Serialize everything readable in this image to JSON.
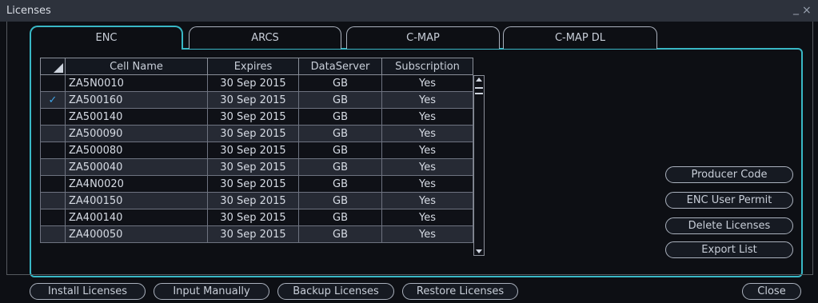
{
  "window": {
    "title": "Licenses",
    "minimize_glyph": "_",
    "close_glyph": "×"
  },
  "tabs": [
    {
      "label": "ENC",
      "active": true
    },
    {
      "label": "ARCS",
      "active": false
    },
    {
      "label": "C-MAP",
      "active": false
    },
    {
      "label": "C-MAP DL",
      "active": false
    }
  ],
  "table": {
    "columns": [
      "Cell Name",
      "Expires",
      "DataServer",
      "Subscription"
    ],
    "rows": [
      {
        "checked": false,
        "cell_name": "ZA5N0010",
        "expires": "30 Sep 2015",
        "dataserver": "GB",
        "subscription": "Yes"
      },
      {
        "checked": true,
        "cell_name": "ZA500160",
        "expires": "30 Sep 2015",
        "dataserver": "GB",
        "subscription": "Yes"
      },
      {
        "checked": false,
        "cell_name": "ZA500140",
        "expires": "30 Sep 2015",
        "dataserver": "GB",
        "subscription": "Yes"
      },
      {
        "checked": false,
        "cell_name": "ZA500090",
        "expires": "30 Sep 2015",
        "dataserver": "GB",
        "subscription": "Yes"
      },
      {
        "checked": false,
        "cell_name": "ZA500080",
        "expires": "30 Sep 2015",
        "dataserver": "GB",
        "subscription": "Yes"
      },
      {
        "checked": false,
        "cell_name": "ZA500040",
        "expires": "30 Sep 2015",
        "dataserver": "GB",
        "subscription": "Yes"
      },
      {
        "checked": false,
        "cell_name": "ZA4N0020",
        "expires": "30 Sep 2015",
        "dataserver": "GB",
        "subscription": "Yes"
      },
      {
        "checked": false,
        "cell_name": "ZA400150",
        "expires": "30 Sep 2015",
        "dataserver": "GB",
        "subscription": "Yes"
      },
      {
        "checked": false,
        "cell_name": "ZA400140",
        "expires": "30 Sep 2015",
        "dataserver": "GB",
        "subscription": "Yes"
      },
      {
        "checked": false,
        "cell_name": "ZA400050",
        "expires": "30 Sep 2015",
        "dataserver": "GB",
        "subscription": "Yes"
      }
    ],
    "check_glyph": "✓"
  },
  "side_buttons": {
    "producer_code": "Producer Code",
    "enc_user_permit": "ENC User Permit",
    "delete_licenses": "Delete Licenses",
    "export_list": "Export List"
  },
  "footer_buttons": {
    "install_licenses": "Install Licenses",
    "input_manually": "Input Manually",
    "backup_licenses": "Backup Licenses",
    "restore_licenses": "Restore Licenses",
    "close": "Close"
  },
  "colors": {
    "background": "#0d0f14",
    "titlebar": "#2d323c",
    "accent_cyan": "#39b8c6",
    "check_blue": "#3fa6e9",
    "row_alt": "#262a34"
  }
}
